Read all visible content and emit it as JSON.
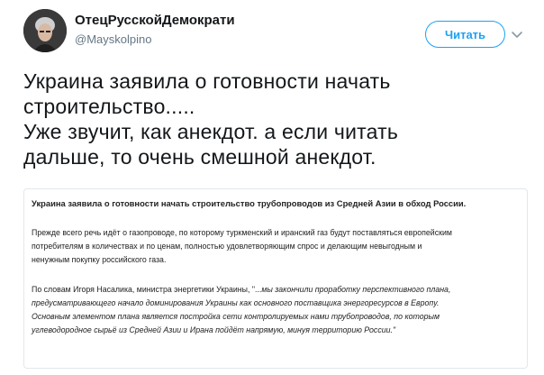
{
  "author": {
    "display_name": "ОтецРусскойДемократи",
    "handle": "@Mayskolpino"
  },
  "actions": {
    "follow_label": "Читать",
    "menu_icon": "chevron-down-icon"
  },
  "tweet": {
    "lines": [
      "Украина заявила о готовности начать",
      "строительство.....",
      "Уже звучит, как анекдот. а если читать",
      "дальше, то очень смешной анекдот."
    ]
  },
  "attached_article": {
    "title": "Украина заявила о готовности начать строительство трубопроводов из Средней Азии в обход России.",
    "paragraph1_lines": [
      "Прежде всего речь идёт о газопроводе, по которому туркменский и иранский газ будут поставляться европейским",
      "потребителям в количествах и по ценам, полностью удовлетворяющим спрос и делающим невыгодным и",
      "ненужным покупку российского газа."
    ],
    "paragraph2_intro": "По словам Игоря Насалика, министра энергетики Украины, \"...",
    "paragraph2_lines": [
      "мы закончили проработку перспективного плана,",
      "предусматривающего начало доминирования Украины как основного поставщика энергоресурсов в Европу.",
      "Основным элементом плана является постройка сети контролируемых нами  трубопроводов, по которым",
      "углеводородное сырьё из Средней Азии и Ирана пойдёт напрямую, минуя территорию России.\""
    ]
  },
  "colors": {
    "accent": "#1da1f2",
    "text_primary": "#14171a",
    "text_secondary": "#657786",
    "border": "#e1e8ed"
  }
}
